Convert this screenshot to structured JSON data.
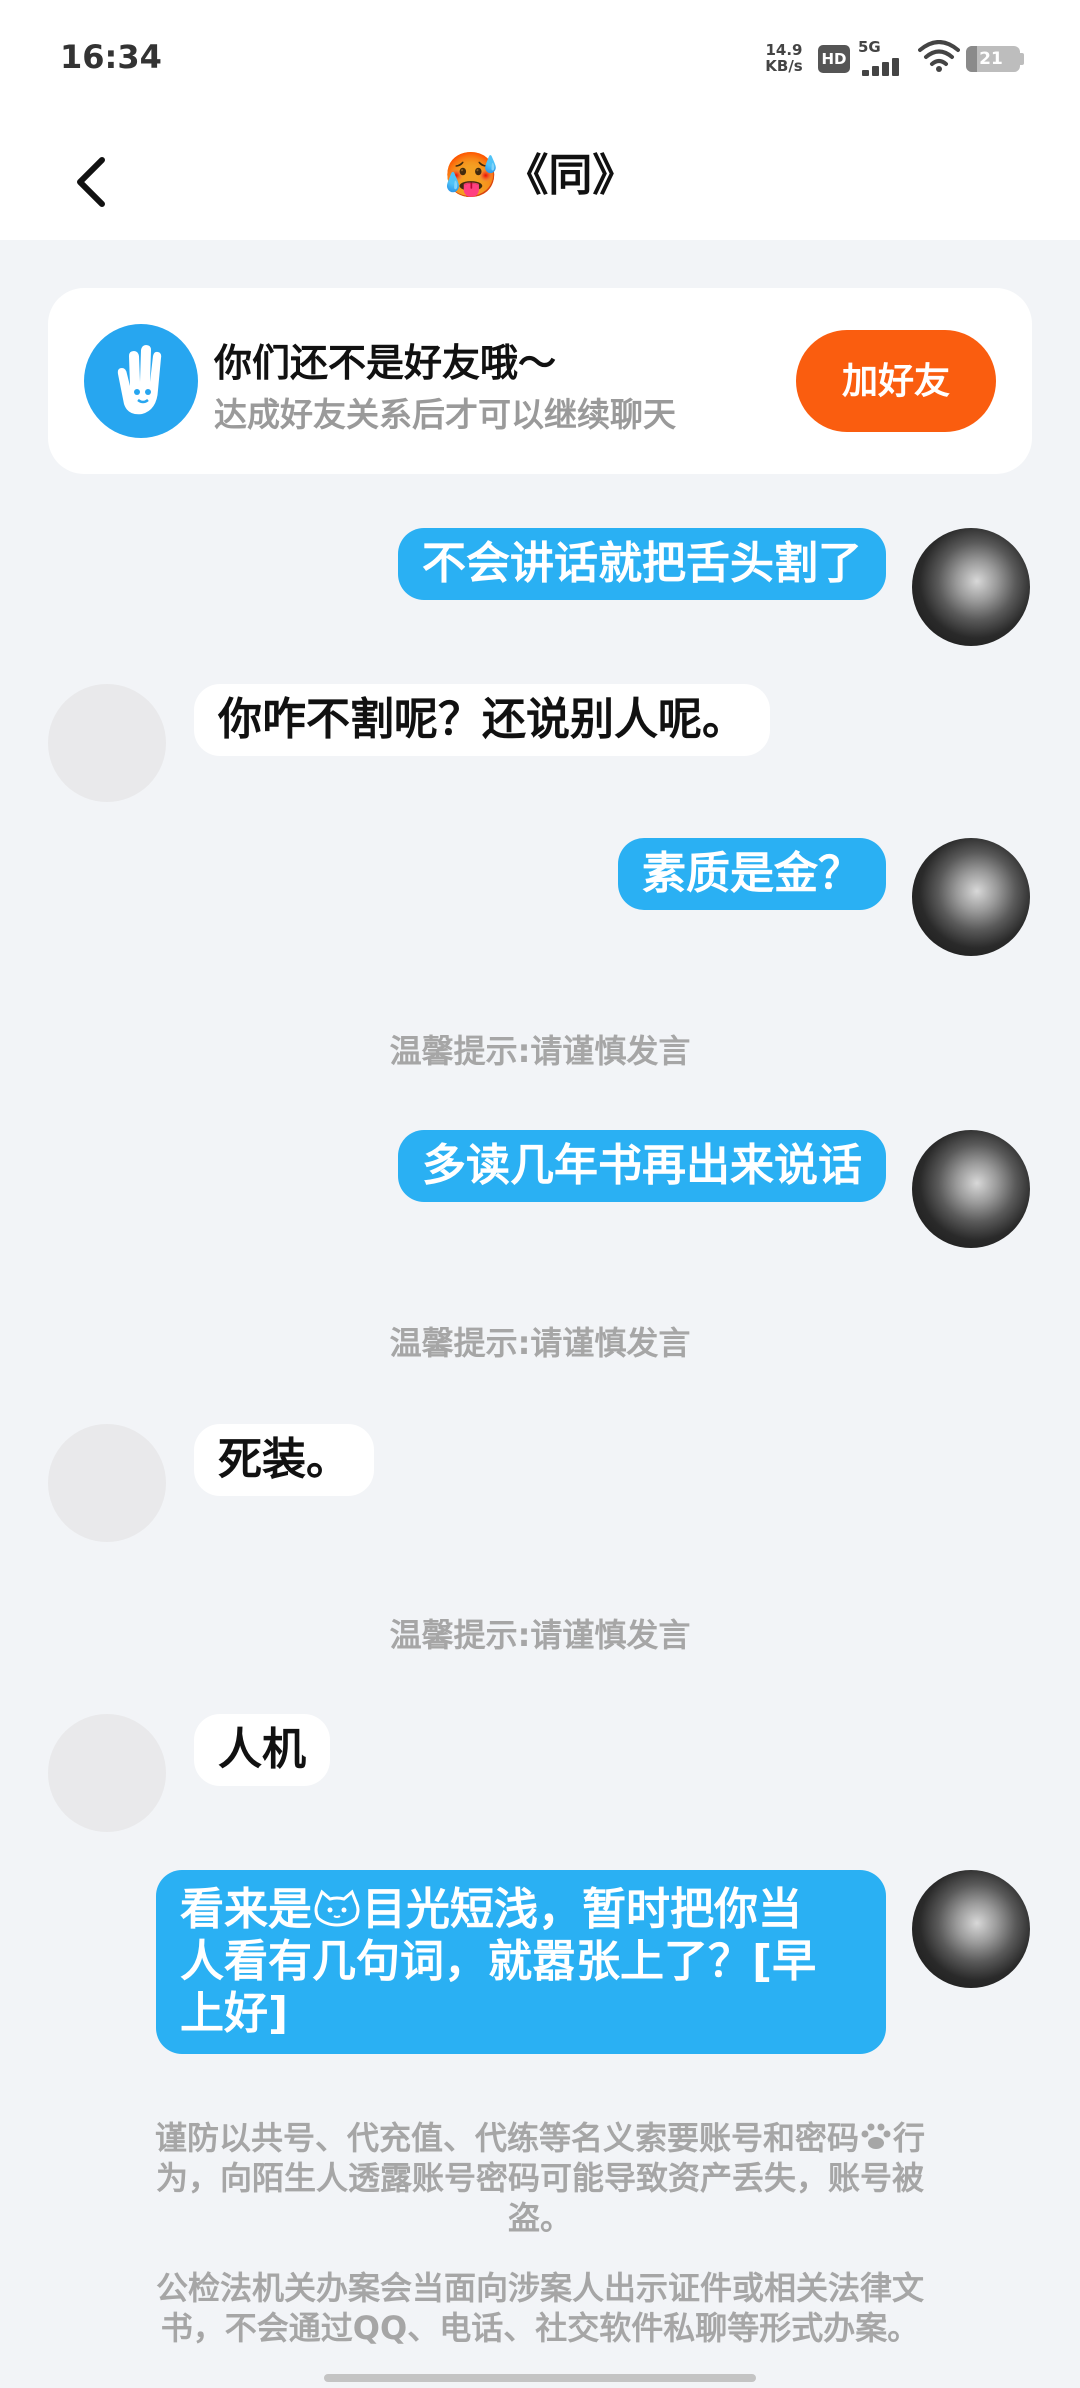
{
  "status_bar": {
    "time": "16:34",
    "net_speed_value": "14.9",
    "net_speed_unit": "KB/s",
    "hd": "HD",
    "network": "5G",
    "battery_level": "21"
  },
  "header": {
    "title": "《同》",
    "title_emoji": "🥵"
  },
  "friend_card": {
    "title": "你们还不是好友哦～",
    "subtitle": "达成好友关系后才可以继续聊天",
    "add_button": "加好友"
  },
  "messages": [
    {
      "from": "self",
      "text": "不会讲话就把舌头割了"
    },
    {
      "from": "other",
      "text": "你咋不割呢？还说别人呢。"
    },
    {
      "from": "self",
      "text": "素质是金？"
    },
    {
      "from": "system",
      "text": "温馨提示:请谨慎发言"
    },
    {
      "from": "self",
      "text": "多读几年书再出来说话"
    },
    {
      "from": "system",
      "text": "温馨提示:请谨慎发言"
    },
    {
      "from": "other",
      "text": "死装。"
    },
    {
      "from": "system",
      "text": "温馨提示:请谨慎发言"
    },
    {
      "from": "other",
      "text": "人机"
    },
    {
      "from": "self",
      "text_line1_a": "看来是",
      "text_line1_b": "目光短浅，暂时把你当",
      "text_line2": "人看有几句词，就嚣张上了？[早",
      "text_line3": "上好]"
    }
  ],
  "notices": {
    "account_line1": "谨防以共号、代充值、代练等名义索要账号和密码",
    "account_line2": "行",
    "account_line3": "为，向陌生人透露账号密码可能导致资产丢失，账号被",
    "account_line4": "盗。",
    "police_line1": "公检法机关办案会当面向涉案人出示证件或相关法律文",
    "police_line2": "书，不会通过QQ、电话、社交软件私聊等形式办案。"
  },
  "colors": {
    "self_bubble": "#2ab0f3",
    "add_button": "#fa5d0f",
    "tip_text": "#a6a6a6"
  },
  "icons": [
    "back-icon",
    "hand-icon",
    "wifi-icon",
    "signal-icon",
    "battery-icon",
    "paw-icon",
    "cat-face-icon"
  ]
}
